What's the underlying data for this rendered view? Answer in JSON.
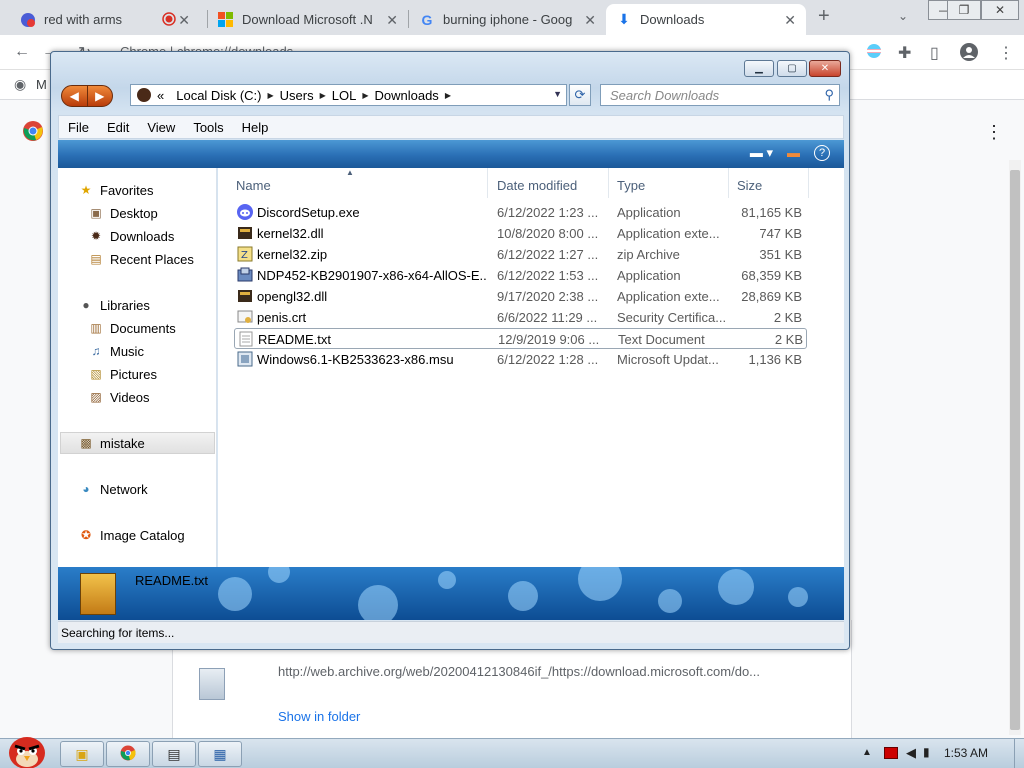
{
  "chrome": {
    "tabs": [
      {
        "title": "red with arms",
        "favicon": "app-icon",
        "active": false
      },
      {
        "title": "Download Microsoft .N",
        "favicon": "microsoft-icon",
        "active": false
      },
      {
        "title": "burning iphone - Goog",
        "favicon": "google-icon",
        "active": false
      },
      {
        "title": "Downloads",
        "favicon": "download-icon",
        "active": true
      }
    ],
    "new_tab": "+",
    "bookmark_initial": "M",
    "address_text": "Chrome | chrome://downloads"
  },
  "downloads_page": {
    "item_url": "http://web.archive.org/web/20200412130846if_/https://download.microsoft.com/do...",
    "show_in_folder": "Show in folder"
  },
  "explorer": {
    "address": {
      "overflow": "«",
      "crumbs": [
        "Local Disk (C:)",
        "Users",
        "LOL",
        "Downloads"
      ]
    },
    "search_placeholder": "Search Downloads",
    "menu": [
      "File",
      "Edit",
      "View",
      "Tools",
      "Help"
    ],
    "nav": {
      "favorites": "Favorites",
      "desktop": "Desktop",
      "downloads": "Downloads",
      "recent_places": "Recent Places",
      "libraries": "Libraries",
      "documents": "Documents",
      "music": "Music",
      "pictures": "Pictures",
      "videos": "Videos",
      "mistake": "mistake",
      "network": "Network",
      "image_catalog": "Image Catalog"
    },
    "columns": {
      "name": "Name",
      "date": "Date modified",
      "type": "Type",
      "size": "Size"
    },
    "files": [
      {
        "name": "DiscordSetup.exe",
        "date": "6/12/2022 1:23 ...",
        "type": "Application",
        "size": "81,165 KB",
        "icon": "discord-icon"
      },
      {
        "name": "kernel32.dll",
        "date": "10/8/2020 8:00 ...",
        "type": "Application exte...",
        "size": "747 KB",
        "icon": "dll-icon"
      },
      {
        "name": "kernel32.zip",
        "date": "6/12/2022 1:27 ...",
        "type": "zip Archive",
        "size": "351 KB",
        "icon": "zip-icon"
      },
      {
        "name": "NDP452-KB2901907-x86-x64-AllOS-E...",
        "date": "6/12/2022 1:53 ...",
        "type": "Application",
        "size": "68,359 KB",
        "icon": "installer-icon"
      },
      {
        "name": "opengl32.dll",
        "date": "9/17/2020 2:38 ...",
        "type": "Application exte...",
        "size": "28,869 KB",
        "icon": "dll-icon"
      },
      {
        "name": "penis.crt",
        "date": "6/6/2022 11:29 ...",
        "type": "Security Certifica...",
        "size": "2 KB",
        "icon": "certificate-icon"
      },
      {
        "name": "README.txt",
        "date": "12/9/2019 9:06 ...",
        "type": "Text Document",
        "size": "2 KB",
        "icon": "text-file-icon"
      },
      {
        "name": "Windows6.1-KB2533623-x86.msu",
        "date": "6/12/2022 1:28 ...",
        "type": "Microsoft Updat...",
        "size": "1,136 KB",
        "icon": "update-package-icon"
      }
    ],
    "details_name": "README.txt",
    "status": "Searching for items..."
  },
  "taskbar": {
    "clock": "1:53 AM"
  },
  "colors": {
    "explorer_bar": "#2a6fb5",
    "chrome_tabstrip": "#dee1e6",
    "link": "#1a73e8"
  }
}
